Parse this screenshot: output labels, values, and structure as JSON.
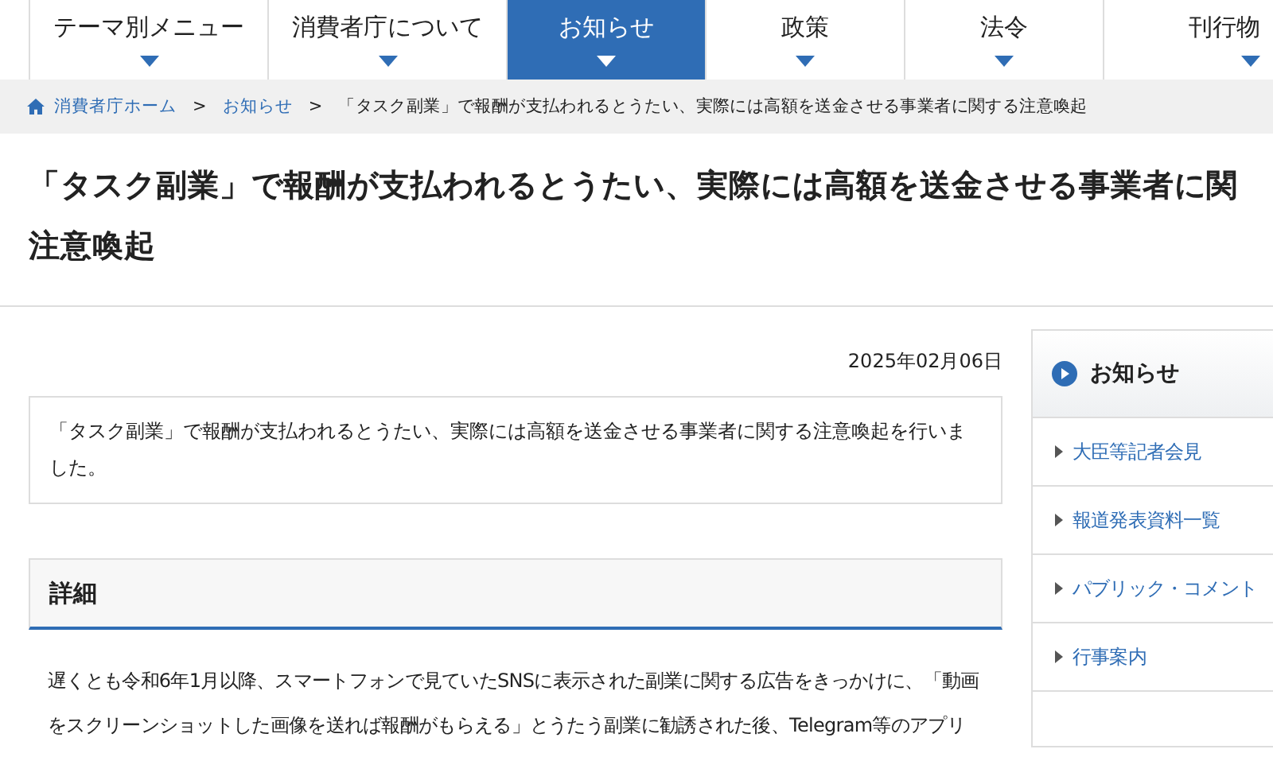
{
  "nav": [
    {
      "label": "テーマ別メニュー",
      "selected": false
    },
    {
      "label": "消費者庁について",
      "selected": false
    },
    {
      "label": "お知らせ",
      "selected": true
    },
    {
      "label": "政策",
      "selected": false
    },
    {
      "label": "法令",
      "selected": false
    },
    {
      "label": "刊行物",
      "selected": false
    }
  ],
  "breadcrumb": {
    "links": [
      "消費者庁ホーム",
      "お知らせ"
    ],
    "separators": [
      ">",
      ">"
    ],
    "current": "「タスク副業」で報酬が支払われるとうたい、実際には高額を送金させる事業者に関する注意喚起"
  },
  "title_lines": [
    "「タスク副業」で報酬が支払われるとうたい、実際には高額を送金させる事業者に関",
    "注意喚起"
  ],
  "date": "2025年02月06日",
  "summary": "「タスク副業」で報酬が支払われるとうたい、実際には高額を送金させる事業者に関する注意喚起を行いました。",
  "detail": {
    "heading": "詳細",
    "lines": [
      "遅くとも令和6年1月以降、スマートフォンで見ていたSNSに表示された副業に関する広告をきっかけに、「動画",
      "をスクリーンショットした画像を送れば報酬がもらえる」とうたう副業に勧誘された後、Telegram等のアプリ"
    ]
  },
  "sidebar": {
    "title": "お知らせ",
    "items": [
      "大臣等記者会見",
      "報道発表資料一覧",
      "パブリック・コメント",
      "行事案内"
    ]
  }
}
